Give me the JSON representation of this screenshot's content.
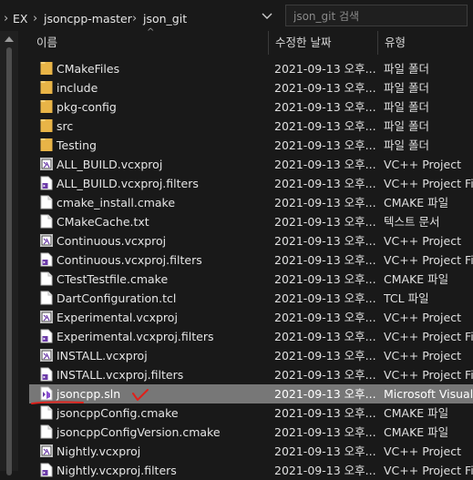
{
  "breadcrumb": {
    "items": [
      "EX",
      "jsoncpp-master",
      "json_git"
    ],
    "separator": "›"
  },
  "search": {
    "placeholder": "json_git 검색"
  },
  "columns": {
    "name": "이름",
    "date": "수정한 날짜",
    "type": "유형"
  },
  "files": [
    {
      "name": "CMakeFiles",
      "date": "2021-09-13 오후...",
      "type": "파일 폴더",
      "icon": "folder-icon"
    },
    {
      "name": "include",
      "date": "2021-09-13 오후...",
      "type": "파일 폴더",
      "icon": "folder-icon"
    },
    {
      "name": "pkg-config",
      "date": "2021-09-13 오후...",
      "type": "파일 폴더",
      "icon": "folder-icon"
    },
    {
      "name": "src",
      "date": "2021-09-13 오후...",
      "type": "파일 폴더",
      "icon": "folder-icon"
    },
    {
      "name": "Testing",
      "date": "2021-09-13 오후...",
      "type": "파일 폴더",
      "icon": "folder-icon"
    },
    {
      "name": "ALL_BUILD.vcxproj",
      "date": "2021-09-13 오후...",
      "type": "VC++ Project",
      "icon": "vcxproj-icon"
    },
    {
      "name": "ALL_BUILD.vcxproj.filters",
      "date": "2021-09-13 오후...",
      "type": "VC++ Project Filt",
      "icon": "filters-icon"
    },
    {
      "name": "cmake_install.cmake",
      "date": "2021-09-13 오후...",
      "type": "CMAKE 파일",
      "icon": "document-icon"
    },
    {
      "name": "CMakeCache.txt",
      "date": "2021-09-13 오후...",
      "type": "텍스트 문서",
      "icon": "document-icon"
    },
    {
      "name": "Continuous.vcxproj",
      "date": "2021-09-13 오후...",
      "type": "VC++ Project",
      "icon": "vcxproj-icon"
    },
    {
      "name": "Continuous.vcxproj.filters",
      "date": "2021-09-13 오후...",
      "type": "VC++ Project Filt",
      "icon": "filters-icon"
    },
    {
      "name": "CTestTestfile.cmake",
      "date": "2021-09-13 오후...",
      "type": "CMAKE 파일",
      "icon": "document-icon"
    },
    {
      "name": "DartConfiguration.tcl",
      "date": "2021-09-13 오후...",
      "type": "TCL 파일",
      "icon": "document-icon"
    },
    {
      "name": "Experimental.vcxproj",
      "date": "2021-09-13 오후...",
      "type": "VC++ Project",
      "icon": "vcxproj-icon"
    },
    {
      "name": "Experimental.vcxproj.filters",
      "date": "2021-09-13 오후...",
      "type": "VC++ Project Filt",
      "icon": "filters-icon"
    },
    {
      "name": "INSTALL.vcxproj",
      "date": "2021-09-13 오후...",
      "type": "VC++ Project",
      "icon": "vcxproj-icon"
    },
    {
      "name": "INSTALL.vcxproj.filters",
      "date": "2021-09-13 오후...",
      "type": "VC++ Project Filt",
      "icon": "filters-icon"
    },
    {
      "name": "jsoncpp.sln",
      "date": "2021-09-13 오후...",
      "type": "Microsoft Visual",
      "icon": "sln-icon",
      "selected": true
    },
    {
      "name": "jsoncppConfig.cmake",
      "date": "2021-09-13 오후...",
      "type": "CMAKE 파일",
      "icon": "document-icon"
    },
    {
      "name": "jsoncppConfigVersion.cmake",
      "date": "2021-09-13 오후...",
      "type": "CMAKE 파일",
      "icon": "document-icon"
    },
    {
      "name": "Nightly.vcxproj",
      "date": "2021-09-13 오후...",
      "type": "VC++ Project",
      "icon": "vcxproj-icon"
    },
    {
      "name": "Nightly.vcxproj.filters",
      "date": "2021-09-13 오후...",
      "type": "VC++ Project Filt",
      "icon": "filters-icon"
    }
  ],
  "colors": {
    "background": "#191919",
    "selected_row": "#777777",
    "folder": "#e8b447",
    "annotation": "#e0201a"
  }
}
